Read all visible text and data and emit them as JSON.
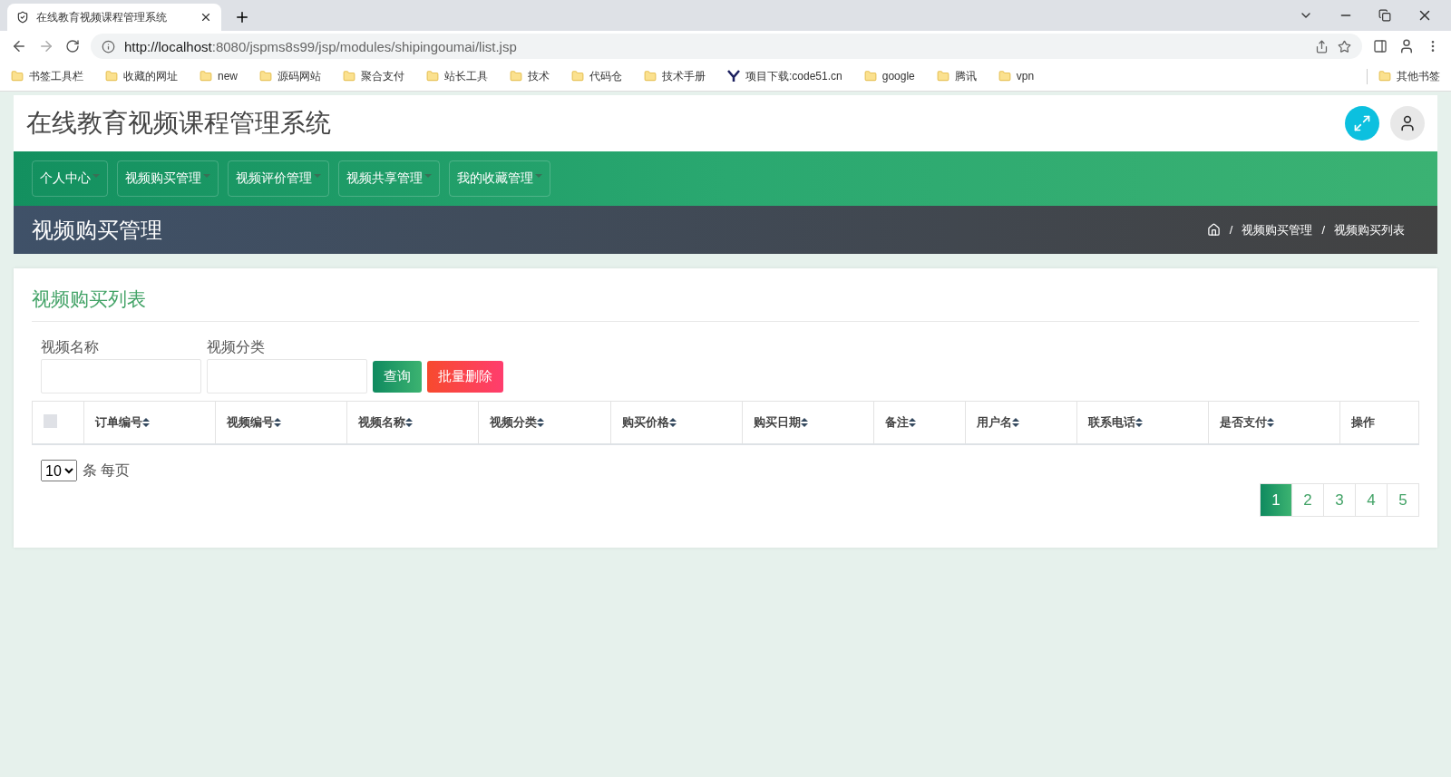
{
  "browser": {
    "tab_title": "在线教育视频课程管理系统",
    "url_host": "http://localhost",
    "url_rest": ":8080/jspms8s99/jsp/modules/shipingoumai/list.jsp",
    "bookmarks": [
      {
        "label": "书签工具栏",
        "kind": "folder"
      },
      {
        "label": "收藏的网址",
        "kind": "folder"
      },
      {
        "label": "new",
        "kind": "folder"
      },
      {
        "label": "源码网站",
        "kind": "folder"
      },
      {
        "label": "聚合支付",
        "kind": "folder"
      },
      {
        "label": "站长工具",
        "kind": "folder"
      },
      {
        "label": "技术",
        "kind": "folder"
      },
      {
        "label": "代码仓",
        "kind": "folder"
      },
      {
        "label": "技术手册",
        "kind": "folder"
      },
      {
        "label": "项目下载:code51.cn",
        "kind": "site"
      },
      {
        "label": "google",
        "kind": "folder"
      },
      {
        "label": "腾讯",
        "kind": "folder"
      },
      {
        "label": "vpn",
        "kind": "folder"
      }
    ],
    "other_bookmarks": "其他书签"
  },
  "header": {
    "title": "在线教育视频课程管理系统"
  },
  "nav": [
    {
      "label": "个人中心"
    },
    {
      "label": "视频购买管理"
    },
    {
      "label": "视频评价管理"
    },
    {
      "label": "视频共享管理"
    },
    {
      "label": "我的收藏管理"
    }
  ],
  "page_header": {
    "title": "视频购买管理",
    "breadcrumb": [
      {
        "separator": "/",
        "label": "视频购买管理"
      },
      {
        "separator": "/",
        "label": "视频购买列表"
      }
    ]
  },
  "card": {
    "title": "视频购买列表",
    "filters": [
      {
        "label": "视频名称"
      },
      {
        "label": "视频分类"
      }
    ],
    "buttons": [
      {
        "label": "查询",
        "kind": "primary"
      },
      {
        "label": "批量删除",
        "kind": "danger"
      }
    ],
    "select_all": {
      "checked": false
    },
    "columns": [
      {
        "label": "订单编号",
        "sortable": true
      },
      {
        "label": "视频编号",
        "sortable": true
      },
      {
        "label": "视频名称",
        "sortable": true
      },
      {
        "label": "视频分类",
        "sortable": true
      },
      {
        "label": "购买价格",
        "sortable": true
      },
      {
        "label": "购买日期",
        "sortable": true
      },
      {
        "label": "备注",
        "sortable": true
      },
      {
        "label": "用户名",
        "sortable": true
      },
      {
        "label": "联系电话",
        "sortable": true
      },
      {
        "label": "是否支付",
        "sortable": true
      },
      {
        "label": "操作",
        "sortable": false
      }
    ],
    "page_size": "10",
    "page_size_suffix": "条 每页",
    "pages": [
      {
        "label": "1",
        "selected": true
      },
      {
        "label": "2",
        "selected": false
      },
      {
        "label": "3",
        "selected": false
      },
      {
        "label": "4",
        "selected": false
      },
      {
        "label": "5",
        "selected": false
      }
    ]
  }
}
